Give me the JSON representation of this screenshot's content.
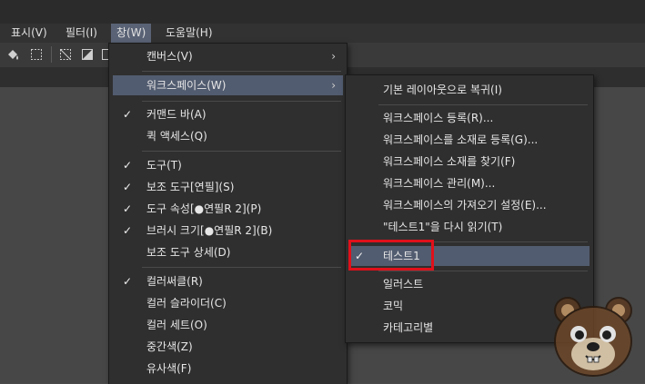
{
  "menubar": {
    "items": [
      {
        "label": "표시(V)"
      },
      {
        "label": "필터(I)"
      },
      {
        "label": "창(W)"
      },
      {
        "label": "도움말(H)"
      }
    ]
  },
  "window_menu": {
    "items": [
      {
        "label": "캔버스(V)",
        "arrow": "›"
      },
      {
        "label": "워크스페이스(W)",
        "arrow": "›"
      },
      {
        "label": "커맨드 바(A)",
        "check": "✓"
      },
      {
        "label": "퀵 액세스(Q)"
      },
      {
        "label": "도구(T)",
        "check": "✓"
      },
      {
        "label": "보조 도구[연필](S)",
        "check": "✓"
      },
      {
        "label": "도구 속성[●연필R 2](P)",
        "check": "✓"
      },
      {
        "label": "브러시 크기[●연필R 2](B)",
        "check": "✓"
      },
      {
        "label": "보조 도구 상세(D)"
      },
      {
        "label": "컬러써클(R)",
        "check": "✓"
      },
      {
        "label": "컬러 슬라이더(C)"
      },
      {
        "label": "컬러 세트(O)"
      },
      {
        "label": "중간색(Z)"
      },
      {
        "label": "유사색(F)"
      }
    ]
  },
  "workspace_submenu": {
    "items": [
      {
        "label": "기본 레이아웃으로 복귀(I)"
      },
      {
        "label": "워크스페이스 등록(R)..."
      },
      {
        "label": "워크스페이스를 소재로 등록(G)..."
      },
      {
        "label": "워크스페이스 소재를 찾기(F)"
      },
      {
        "label": "워크스페이스 관리(M)..."
      },
      {
        "label": "워크스페이스의 가져오기 설정(E)..."
      },
      {
        "label": "\"테스트1\"을 다시 읽기(T)"
      },
      {
        "label": "테스트1",
        "check": "✓"
      },
      {
        "label": "일러스트"
      },
      {
        "label": "코믹"
      },
      {
        "label": "카테고리별"
      }
    ]
  },
  "colors": {
    "highlight": "#525c70",
    "annotation_box": "#e0101a"
  }
}
